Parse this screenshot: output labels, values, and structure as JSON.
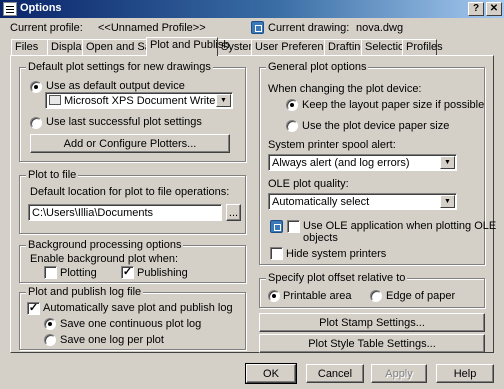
{
  "window": {
    "title": "Options"
  },
  "header": {
    "profile_label": "Current profile:",
    "profile_value": "<<Unnamed Profile>>",
    "drawing_label": "Current drawing:",
    "drawing_value": "nova.dwg"
  },
  "tabs": [
    "Files",
    "Display",
    "Open and Save",
    "Plot and Publish",
    "System",
    "User Preferences",
    "Drafting",
    "Selection",
    "Profiles"
  ],
  "active_tab": "Plot and Publish",
  "default_plot": {
    "legend": "Default plot settings for new drawings",
    "use_default_label": "Use as default output device",
    "use_default_selected": true,
    "device": "Microsoft XPS Document Writer",
    "use_last_label": "Use last successful plot settings",
    "add_plotters_label": "Add or Configure Plotters..."
  },
  "plot_to_file": {
    "legend": "Plot to file",
    "location_label": "Default location for plot to file operations:",
    "path": "C:\\Users\\Illia\\Documents",
    "browse_label": "..."
  },
  "background": {
    "legend": "Background processing options",
    "enable_label": "Enable background plot when:",
    "plotting_label": "Plotting",
    "plotting_checked": false,
    "publishing_label": "Publishing",
    "publishing_checked": true
  },
  "log": {
    "legend": "Plot and publish log file",
    "auto_save_label": "Automatically save plot and publish log",
    "auto_save_checked": true,
    "continuous_label": "Save one continuous plot log",
    "continuous_selected": true,
    "per_plot_label": "Save one log per plot"
  },
  "general": {
    "legend": "General plot options",
    "changing_label": "When changing the plot device:",
    "keep_layout_label": "Keep the layout paper size if possible",
    "keep_layout_selected": true,
    "use_device_label": "Use the plot device paper size",
    "spool_label": "System printer spool alert:",
    "spool_value": "Always alert (and log errors)",
    "ole_quality_label": "OLE plot quality:",
    "ole_quality_value": "Automatically select",
    "ole_app_label_1": "Use OLE application when plotting OLE",
    "ole_app_label_2": "objects",
    "ole_app_checked": false,
    "hide_printers_label": "Hide system printers",
    "hide_printers_checked": false
  },
  "offset": {
    "legend": "Specify plot offset relative to",
    "printable_label": "Printable area",
    "printable_selected": true,
    "edge_label": "Edge of paper"
  },
  "buttons": {
    "stamp": "Plot Stamp Settings...",
    "style_table": "Plot Style Table Settings...",
    "ok": "OK",
    "cancel": "Cancel",
    "apply": "Apply",
    "help": "Help"
  }
}
